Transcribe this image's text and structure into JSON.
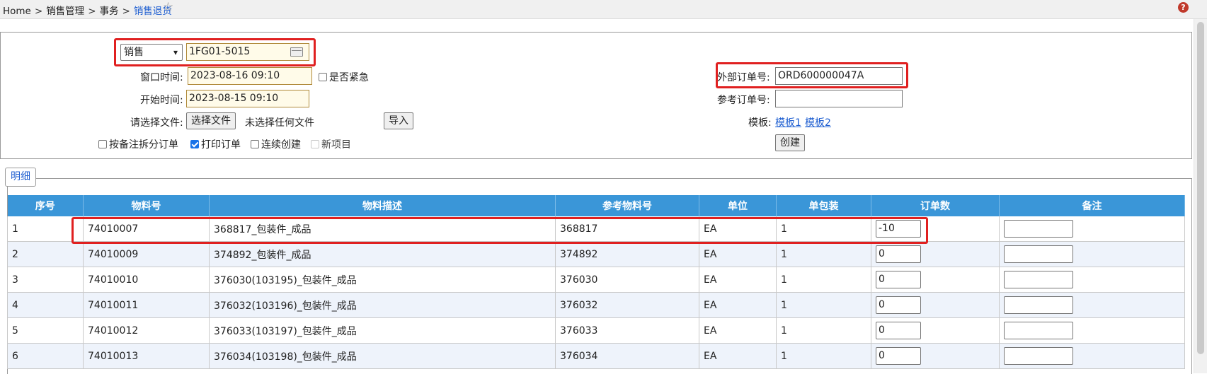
{
  "breadcrumb": {
    "home": "Home",
    "level1": "销售管理",
    "level2": "事务",
    "current": "销售退货",
    "sep": ">"
  },
  "icons": {
    "star": "☆",
    "help": "?"
  },
  "form": {
    "type_select": {
      "value": "销售",
      "caret": "▾"
    },
    "customer_code": "1FG01-5015",
    "window_time": {
      "label": "窗口时间:",
      "value": "2023-08-16 09:10"
    },
    "urgent": {
      "label": "是否紧急",
      "checked": false
    },
    "start_time": {
      "label": "开始时间:",
      "value": "2023-08-15 09:10"
    },
    "file": {
      "label": "请选择文件:",
      "button": "选择文件",
      "status": "未选择任何文件"
    },
    "import_button": "导入",
    "options": [
      {
        "label": "按备注拆分订单",
        "checked": false
      },
      {
        "label": "打印订单",
        "checked": true
      },
      {
        "label": "连续创建",
        "checked": false
      },
      {
        "label": "新项目",
        "checked": false,
        "disabled": true
      }
    ],
    "external_order": {
      "label": "外部订单号:",
      "value": "ORD600000047A"
    },
    "reference_order": {
      "label": "参考订单号:",
      "value": ""
    },
    "template": {
      "label": "模板:",
      "links": [
        "模板1",
        "模板2"
      ]
    },
    "create_button": "创建"
  },
  "detail": {
    "legend": "明细",
    "columns": [
      "序号",
      "物料号",
      "物料描述",
      "参考物料号",
      "单位",
      "单包装",
      "订单数",
      "备注"
    ],
    "rows": [
      {
        "no": "1",
        "material": "74010007",
        "desc": "368817_包装件_成品",
        "ref": "368817",
        "unit": "EA",
        "pack": "1",
        "qty": "-10",
        "note": ""
      },
      {
        "no": "2",
        "material": "74010009",
        "desc": "374892_包装件_成品",
        "ref": "374892",
        "unit": "EA",
        "pack": "1",
        "qty": "0",
        "note": ""
      },
      {
        "no": "3",
        "material": "74010010",
        "desc": "376030(103195)_包装件_成品",
        "ref": "376030",
        "unit": "EA",
        "pack": "1",
        "qty": "0",
        "note": ""
      },
      {
        "no": "4",
        "material": "74010011",
        "desc": "376032(103196)_包装件_成品",
        "ref": "376032",
        "unit": "EA",
        "pack": "1",
        "qty": "0",
        "note": ""
      },
      {
        "no": "5",
        "material": "74010012",
        "desc": "376033(103197)_包装件_成品",
        "ref": "376033",
        "unit": "EA",
        "pack": "1",
        "qty": "0",
        "note": ""
      },
      {
        "no": "6",
        "material": "74010013",
        "desc": "376034(103198)_包装件_成品",
        "ref": "376034",
        "unit": "EA",
        "pack": "1",
        "qty": "0",
        "note": ""
      }
    ]
  },
  "colors": {
    "header_blue": "#3a96d8",
    "highlight_red": "#e02020",
    "link_blue": "#1f5fd1",
    "alt_row": "#eef3fb"
  }
}
